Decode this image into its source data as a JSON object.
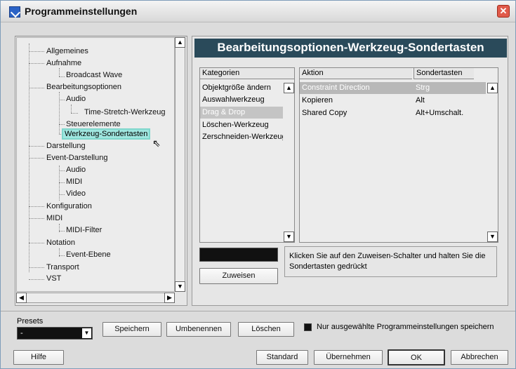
{
  "window": {
    "title": "Programmeinstellungen",
    "close": "✕"
  },
  "tree": {
    "items": [
      "Allgemeines",
      "Aufnahme",
      "Broadcast Wave",
      "Bearbeitungsoptionen",
      "Audio",
      "Time-Stretch-Werkzeug",
      "Steuerelemente",
      "Werkzeug-Sondertasten",
      "Darstellung",
      "Event-Darstellung",
      "Audio",
      "MIDI",
      "Video",
      "Konfiguration",
      "MIDI",
      "MIDI-Filter",
      "Notation",
      "Event-Ebene",
      "Transport",
      "VST"
    ],
    "selected": "Werkzeug-Sondertasten"
  },
  "header": {
    "title": "Bearbeitungsoptionen-Werkzeug-Sondertasten"
  },
  "categories": {
    "column": "Kategorien",
    "items": [
      "Objektgröße ändern",
      "Auswahlwerkzeug",
      "Drag & Drop",
      "Löschen-Werkzeug",
      "Zerschneiden-Werkzeug"
    ],
    "selected": "Drag & Drop"
  },
  "actions": {
    "col_action": "Aktion",
    "col_keys": "Sondertasten",
    "rows": [
      {
        "action": "Constraint Direction",
        "keys": "Strg"
      },
      {
        "action": "Kopieren",
        "keys": "Alt"
      },
      {
        "action": "Shared Copy",
        "keys": "Alt+Umschalt."
      }
    ],
    "selected": "Constraint Direction"
  },
  "assign": {
    "label": "Zuweisen"
  },
  "hint": "Klicken Sie auf den Zuweisen-Schalter und halten Sie die Sondertasten gedrückt",
  "presets": {
    "label": "Presets",
    "value": "-",
    "save": "Speichern",
    "rename": "Umbenennen",
    "delete": "Löschen",
    "only_selected": "Nur ausgewählte Programmeinstellungen speichern"
  },
  "footer": {
    "help": "Hilfe",
    "standard": "Standard",
    "apply": "Übernehmen",
    "ok": "OK",
    "cancel": "Abbrechen"
  }
}
